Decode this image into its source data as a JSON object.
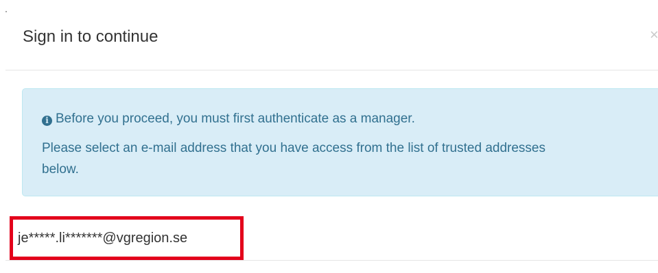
{
  "dialog": {
    "title": "Sign in to continue",
    "close_label": "×"
  },
  "alert": {
    "icon": "info-circle-icon",
    "line1": "Before you proceed, you must first authenticate as a manager.",
    "line2": "Please select an e-mail address that you have access from the list of trusted addresses below."
  },
  "trusted_addresses": [
    {
      "email": "je*****.li*******@vgregion.se",
      "highlighted": true
    }
  ],
  "colors": {
    "alert_background": "#d9edf7",
    "alert_text": "#31708f",
    "highlight_border": "#e3001b"
  }
}
